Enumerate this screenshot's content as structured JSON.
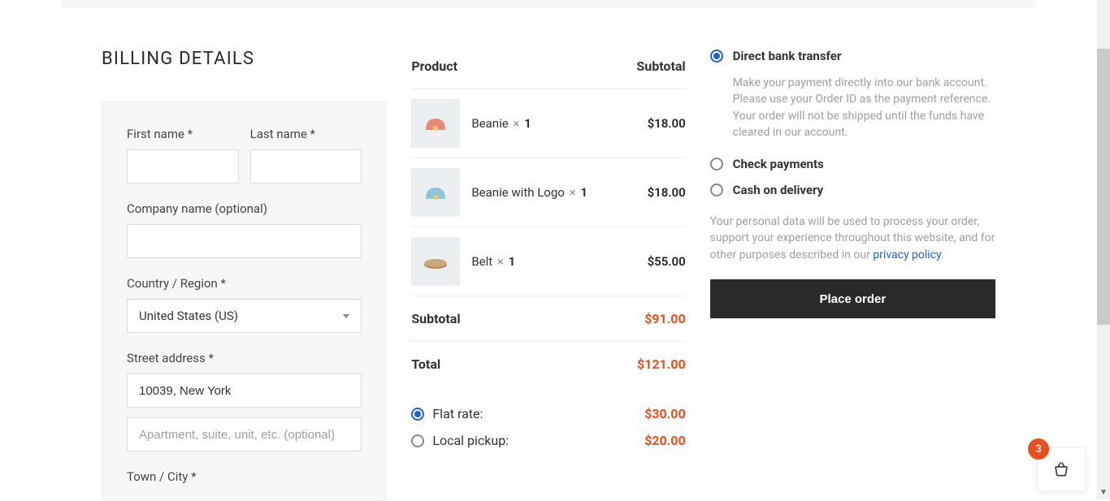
{
  "billing": {
    "title": "BILLING DETAILS",
    "first_name_label": "First name *",
    "last_name_label": "Last name *",
    "company_label": "Company name (optional)",
    "country_label": "Country / Region *",
    "country_value": "United States (US)",
    "street_label": "Street address *",
    "street_value": "10039, New York",
    "street2_placeholder": "Apartment, suite, unit, etc. (optional)",
    "city_label": "Town / City *"
  },
  "order": {
    "product_header": "Product",
    "subtotal_header": "Subtotal",
    "items": [
      {
        "name": "Beanie",
        "qty": "1",
        "price": "$18.00"
      },
      {
        "name": "Beanie with Logo",
        "qty": "1",
        "price": "$18.00"
      },
      {
        "name": "Belt",
        "qty": "1",
        "price": "$55.00"
      }
    ],
    "subtotal_label": "Subtotal",
    "subtotal_value": "$91.00",
    "total_label": "Total",
    "total_value": "$121.00",
    "qty_symbol": "×"
  },
  "shipping": {
    "flat_rate_label": "Flat rate:",
    "flat_rate_price": "$30.00",
    "local_pickup_label": "Local pickup:",
    "local_pickup_price": "$20.00"
  },
  "payment": {
    "bank_label": "Direct bank transfer",
    "bank_desc": "Make your payment directly into our bank account. Please use your Order ID as the payment reference. Your order will not be shipped until the funds have cleared in our account.",
    "check_label": "Check payments",
    "cod_label": "Cash on delivery",
    "privacy_text_1": "Your personal data will be used to process your order, support your experience throughout this website, and for other purposes described in our ",
    "privacy_link": "privacy policy",
    "privacy_text_2": ".",
    "place_order_label": "Place order"
  },
  "cart": {
    "badge_count": "3"
  }
}
